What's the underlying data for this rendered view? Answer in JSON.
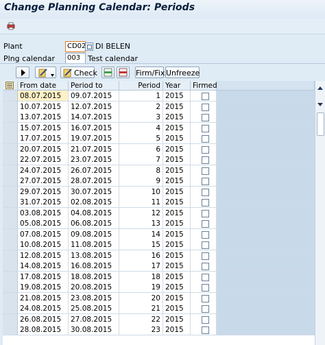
{
  "title": "Change Planning Calendar: Periods",
  "form": {
    "plant_label": "Plant",
    "plant_value": "CD02",
    "plant_desc": "DI BELEN",
    "calendar_label": "Plng calendar",
    "calendar_value": "003",
    "calendar_desc": "Test calendar"
  },
  "toolbar": {
    "check_label": "Check",
    "firmfix_label": "Firm/Fix",
    "unfreeze_label": "Unfreeze"
  },
  "table": {
    "headers": {
      "from": "From date",
      "to": "Period to",
      "period": "Period",
      "year": "Year",
      "firmed": "Firmed"
    },
    "rows": [
      {
        "from": "08.07.2015",
        "to": "09.07.2015",
        "period": "1",
        "year": "2015"
      },
      {
        "from": "10.07.2015",
        "to": "12.07.2015",
        "period": "2",
        "year": "2015"
      },
      {
        "from": "13.07.2015",
        "to": "14.07.2015",
        "period": "3",
        "year": "2015"
      },
      {
        "from": "15.07.2015",
        "to": "16.07.2015",
        "period": "4",
        "year": "2015"
      },
      {
        "from": "17.07.2015",
        "to": "19.07.2015",
        "period": "5",
        "year": "2015"
      },
      {
        "from": "20.07.2015",
        "to": "21.07.2015",
        "period": "6",
        "year": "2015"
      },
      {
        "from": "22.07.2015",
        "to": "23.07.2015",
        "period": "7",
        "year": "2015"
      },
      {
        "from": "24.07.2015",
        "to": "26.07.2015",
        "period": "8",
        "year": "2015"
      },
      {
        "from": "27.07.2015",
        "to": "28.07.2015",
        "period": "9",
        "year": "2015"
      },
      {
        "from": "29.07.2015",
        "to": "30.07.2015",
        "period": "10",
        "year": "2015"
      },
      {
        "from": "31.07.2015",
        "to": "02.08.2015",
        "period": "11",
        "year": "2015"
      },
      {
        "from": "03.08.2015",
        "to": "04.08.2015",
        "period": "12",
        "year": "2015"
      },
      {
        "from": "05.08.2015",
        "to": "06.08.2015",
        "period": "13",
        "year": "2015"
      },
      {
        "from": "07.08.2015",
        "to": "09.08.2015",
        "period": "14",
        "year": "2015"
      },
      {
        "from": "10.08.2015",
        "to": "11.08.2015",
        "period": "15",
        "year": "2015"
      },
      {
        "from": "12.08.2015",
        "to": "13.08.2015",
        "period": "16",
        "year": "2015"
      },
      {
        "from": "14.08.2015",
        "to": "16.08.2015",
        "period": "17",
        "year": "2015"
      },
      {
        "from": "17.08.2015",
        "to": "18.08.2015",
        "period": "18",
        "year": "2015"
      },
      {
        "from": "19.08.2015",
        "to": "20.08.2015",
        "period": "19",
        "year": "2015"
      },
      {
        "from": "21.08.2015",
        "to": "23.08.2015",
        "period": "20",
        "year": "2015"
      },
      {
        "from": "24.08.2015",
        "to": "25.08.2015",
        "period": "21",
        "year": "2015"
      },
      {
        "from": "26.08.2015",
        "to": "27.08.2015",
        "period": "22",
        "year": "2015"
      },
      {
        "from": "28.08.2015",
        "to": "30.08.2015",
        "period": "23",
        "year": "2015"
      }
    ]
  }
}
